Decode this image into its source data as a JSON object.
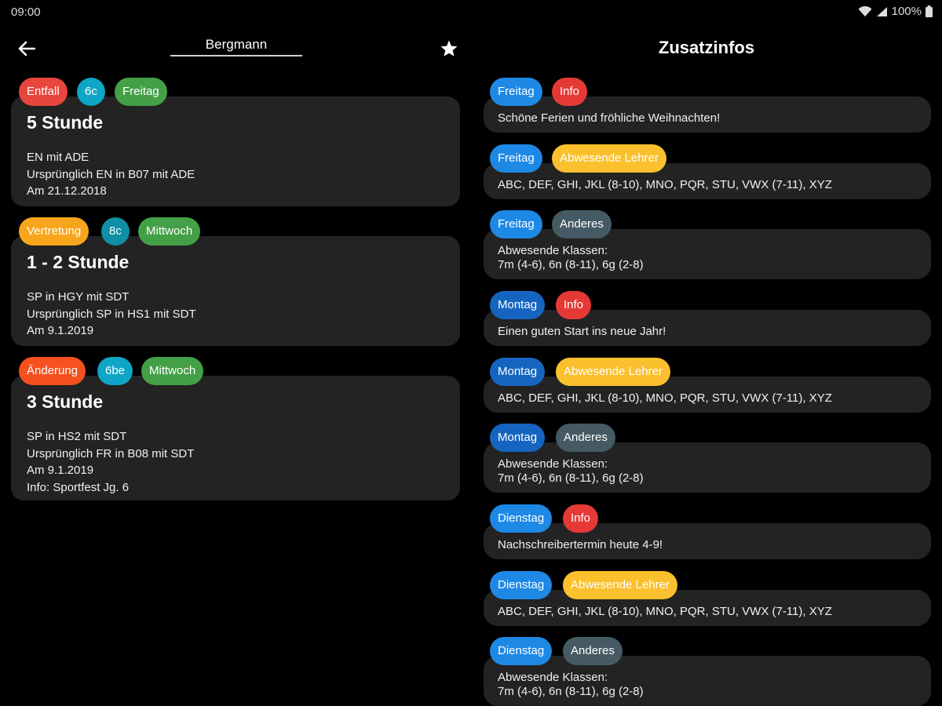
{
  "status": {
    "time": "09:00",
    "battery": "100%"
  },
  "header": {
    "search_value": "Bergmann",
    "right_title": "Zusatzinfos"
  },
  "colors": {
    "entfall": "#e8453c",
    "vertretung": "#f7a51c",
    "aenderung": "#f4511e",
    "class": "#0ea5c6",
    "day": "#43a047",
    "blue_day": "#1e88e5",
    "dark_blue_day": "#1565c0",
    "info": "#e53935",
    "abwesend": "#fbc02d",
    "anderes": "#455a64"
  },
  "lessons": [
    {
      "tags": [
        "Entfall",
        "6c",
        "Freitag"
      ],
      "title": "5 Stunde",
      "lines": [
        "EN mit ADE",
        "Ursprünglich EN in B07 mit ADE",
        "Am 21.12.2018"
      ]
    },
    {
      "tags": [
        "Vertretung",
        "8c",
        "Mittwoch"
      ],
      "title": "1 - 2 Stunde",
      "lines": [
        "SP in HGY mit SDT",
        "Ursprünglich SP in HS1 mit SDT",
        "Am 9.1.2019"
      ]
    },
    {
      "tags": [
        "Änderung",
        "6be",
        "Mittwoch"
      ],
      "title": "3 Stunde",
      "lines": [
        "SP in HS2 mit SDT",
        "Ursprünglich FR in B08 mit SDT",
        "Am 9.1.2019",
        "Info: Sportfest Jg. 6"
      ]
    }
  ],
  "infos": [
    {
      "day": "Freitag",
      "type": "Info",
      "lines": [
        "Schöne Ferien und fröhliche Weihnachten!"
      ]
    },
    {
      "day": "Freitag",
      "type": "Abwesende Lehrer",
      "lines": [
        "ABC, DEF, GHI, JKL (8-10), MNO, PQR, STU, VWX (7-11), XYZ"
      ]
    },
    {
      "day": "Freitag",
      "type": "Anderes",
      "lines": [
        "Abwesende Klassen:",
        "7m (4-6), 6n (8-11), 6g (2-8)"
      ]
    },
    {
      "day": "Montag",
      "type": "Info",
      "lines": [
        "Einen guten Start ins neue Jahr!"
      ]
    },
    {
      "day": "Montag",
      "type": "Abwesende Lehrer",
      "lines": [
        "ABC, DEF, GHI, JKL (8-10), MNO, PQR, STU, VWX (7-11), XYZ"
      ]
    },
    {
      "day": "Montag",
      "type": "Anderes",
      "lines": [
        "Abwesende Klassen:",
        "7m (4-6), 6n (8-11), 6g (2-8)"
      ]
    },
    {
      "day": "Dienstag",
      "type": "Info",
      "lines": [
        "Nachschreibertermin heute 4-9!"
      ]
    },
    {
      "day": "Dienstag",
      "type": "Abwesende Lehrer",
      "lines": [
        "ABC, DEF, GHI, JKL (8-10), MNO, PQR, STU, VWX (7-11), XYZ"
      ]
    },
    {
      "day": "Dienstag",
      "type": "Anderes",
      "lines": [
        "Abwesende Klassen:",
        "7m (4-6), 6n (8-11), 6g (2-8)"
      ]
    }
  ]
}
